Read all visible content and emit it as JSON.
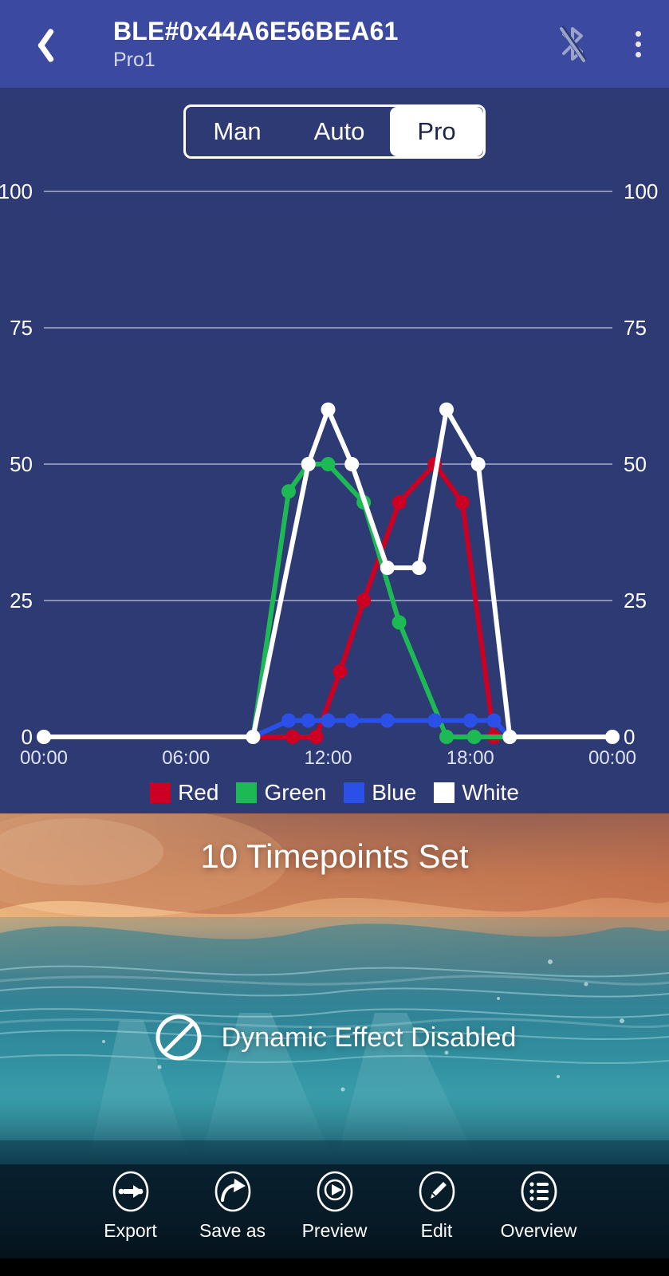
{
  "header": {
    "title": "BLE#0x44A6E56BEA61",
    "subtitle": "Pro1",
    "back_icon": "chevron-left-icon",
    "bluetooth_icon": "bluetooth-disabled-icon",
    "menu_icon": "overflow-menu-icon"
  },
  "mode_tabs": {
    "items": [
      {
        "label": "Man",
        "selected": false
      },
      {
        "label": "Auto",
        "selected": false
      },
      {
        "label": "Pro",
        "selected": true
      }
    ]
  },
  "chart_data": {
    "type": "line",
    "title": "",
    "xlabel": "",
    "ylabel": "",
    "ylim": [
      0,
      100
    ],
    "yticks": [
      0,
      25,
      50,
      75,
      100
    ],
    "ytick_labels_left": [
      "0",
      "25",
      "50",
      "75",
      "100"
    ],
    "ytick_labels_right": [
      "0",
      "25",
      "50",
      "75",
      "100"
    ],
    "xlim": [
      "00:00",
      "24:00"
    ],
    "xticks": [
      "00:00",
      "06:00",
      "12:00",
      "18:00",
      "00:00"
    ],
    "grid": true,
    "legend_position": "bottom",
    "series": [
      {
        "name": "Red",
        "color": "#cc0022",
        "points": [
          {
            "x": "00:00",
            "y": 0
          },
          {
            "x": "10:30",
            "y": 0
          },
          {
            "x": "11:30",
            "y": 0
          },
          {
            "x": "12:30",
            "y": 12
          },
          {
            "x": "13:30",
            "y": 25
          },
          {
            "x": "15:00",
            "y": 43
          },
          {
            "x": "16:30",
            "y": 50
          },
          {
            "x": "17:40",
            "y": 43
          },
          {
            "x": "19:00",
            "y": 0
          },
          {
            "x": "24:00",
            "y": 0
          }
        ]
      },
      {
        "name": "Green",
        "color": "#1db954",
        "points": [
          {
            "x": "00:00",
            "y": 0
          },
          {
            "x": "08:50",
            "y": 0
          },
          {
            "x": "10:20",
            "y": 45
          },
          {
            "x": "11:10",
            "y": 50
          },
          {
            "x": "12:00",
            "y": 50
          },
          {
            "x": "13:30",
            "y": 43
          },
          {
            "x": "15:00",
            "y": 21
          },
          {
            "x": "17:00",
            "y": 0
          },
          {
            "x": "18:10",
            "y": 0
          },
          {
            "x": "24:00",
            "y": 0
          }
        ]
      },
      {
        "name": "Blue",
        "color": "#2b50e8",
        "points": [
          {
            "x": "00:00",
            "y": 0
          },
          {
            "x": "08:50",
            "y": 0
          },
          {
            "x": "10:20",
            "y": 3
          },
          {
            "x": "11:10",
            "y": 3
          },
          {
            "x": "12:00",
            "y": 3
          },
          {
            "x": "13:00",
            "y": 3
          },
          {
            "x": "14:30",
            "y": 3
          },
          {
            "x": "16:30",
            "y": 3
          },
          {
            "x": "18:00",
            "y": 3
          },
          {
            "x": "19:00",
            "y": 3
          },
          {
            "x": "19:40",
            "y": 0
          },
          {
            "x": "24:00",
            "y": 0
          }
        ]
      },
      {
        "name": "White",
        "color": "#ffffff",
        "points": [
          {
            "x": "00:00",
            "y": 0
          },
          {
            "x": "08:50",
            "y": 0
          },
          {
            "x": "11:10",
            "y": 50
          },
          {
            "x": "12:00",
            "y": 60
          },
          {
            "x": "13:00",
            "y": 50
          },
          {
            "x": "14:30",
            "y": 31
          },
          {
            "x": "15:50",
            "y": 31
          },
          {
            "x": "17:00",
            "y": 60
          },
          {
            "x": "18:20",
            "y": 50
          },
          {
            "x": "19:40",
            "y": 0
          },
          {
            "x": "24:00",
            "y": 0
          }
        ]
      }
    ]
  },
  "photo_panel": {
    "timepoints_text": "10 Timepoints Set",
    "dynamic_effect_label": "Dynamic Effect Disabled",
    "dynamic_effect_icon": "no-entry-icon"
  },
  "bottom_nav": {
    "items": [
      {
        "label": "Export",
        "icon": "export-icon"
      },
      {
        "label": "Save as",
        "icon": "share-arrow-icon"
      },
      {
        "label": "Preview",
        "icon": "play-icon"
      },
      {
        "label": "Edit",
        "icon": "pencil-icon"
      },
      {
        "label": "Overview",
        "icon": "list-icon"
      }
    ]
  },
  "colors": {
    "appbar": "#3b4aa0",
    "canvas": "#2d3a73",
    "accent_red": "#cc0022",
    "accent_green": "#1db954",
    "accent_blue": "#2b50e8",
    "accent_white": "#ffffff"
  }
}
